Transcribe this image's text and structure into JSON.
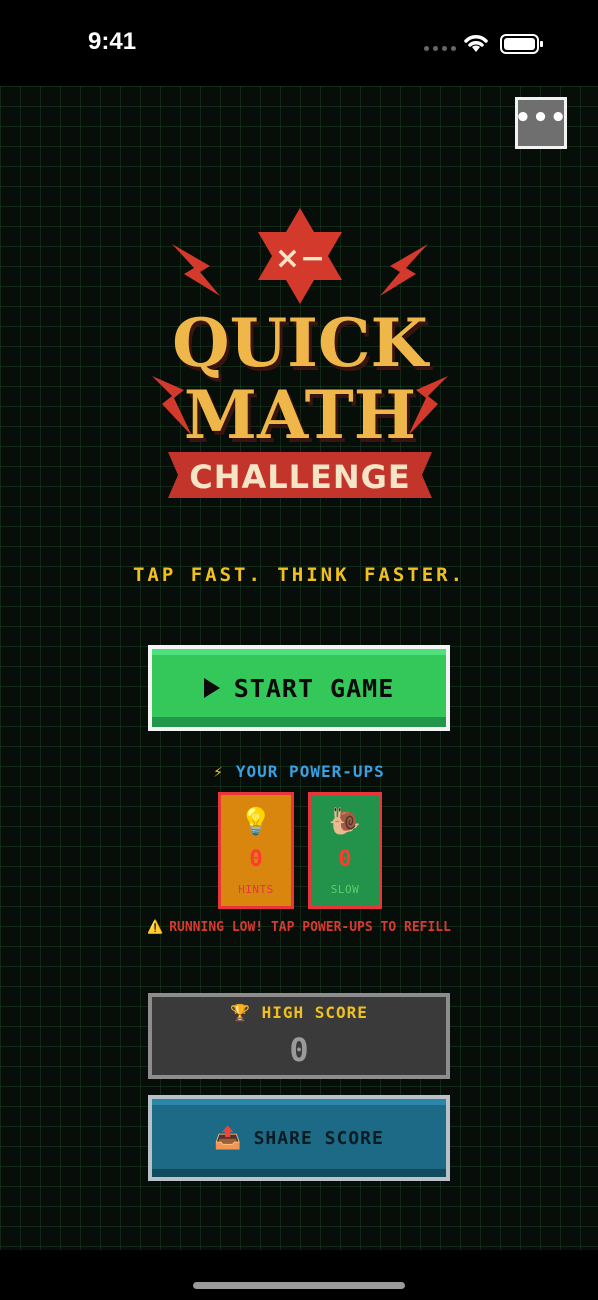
{
  "status_bar": {
    "time": "9:41"
  },
  "menu": {
    "label": "•••"
  },
  "logo": {
    "badge_text": "×−",
    "line1": "QUICK",
    "line2": "MATH",
    "banner": "CHALLENGE"
  },
  "tagline": "TAP FAST. THINK FASTER.",
  "start_button": {
    "label": "START GAME"
  },
  "powerups": {
    "heading_icon": "⚡",
    "heading": "YOUR POWER-UPS",
    "items": [
      {
        "icon": "💡",
        "count": "0",
        "label": "HINTS"
      },
      {
        "icon": "🐌",
        "count": "0",
        "label": "SLOW"
      }
    ],
    "warning_icon": "⚠️",
    "warning": "RUNNING LOW! TAP POWER-UPS TO REFILL"
  },
  "high_score": {
    "icon": "🏆",
    "title": "HIGH SCORE",
    "value": "0"
  },
  "share_button": {
    "icon": "📤",
    "label": "SHARE SCORE"
  },
  "colors": {
    "background": "#070d08",
    "accent_yellow": "#f0c020",
    "start_green": "#34c759",
    "warning_red": "#d83a32",
    "share_blue": "#1c6a86"
  }
}
